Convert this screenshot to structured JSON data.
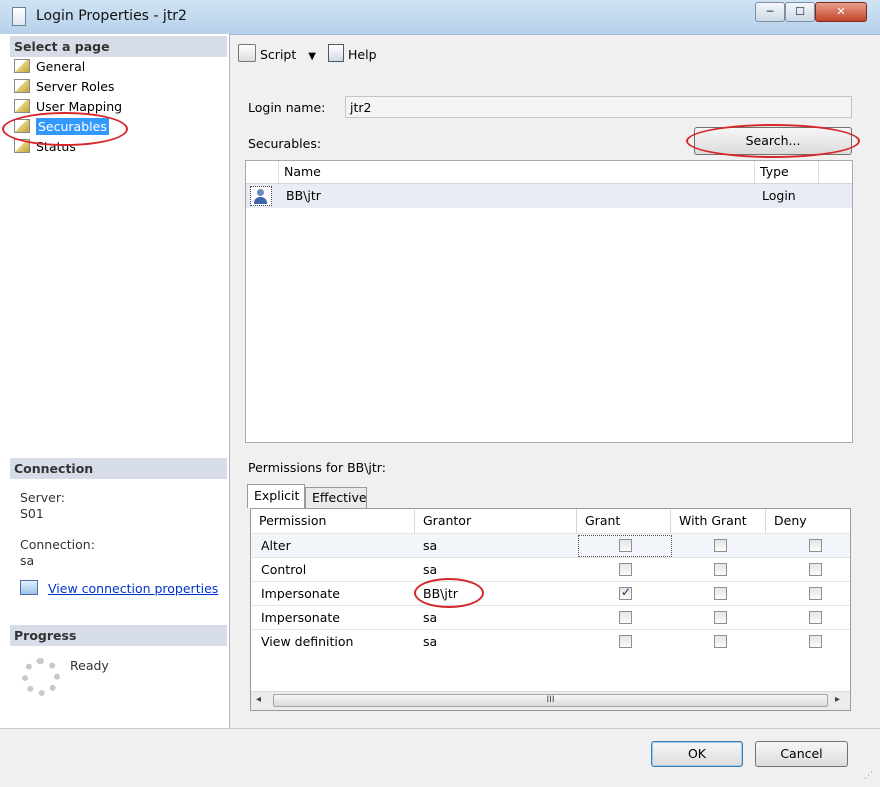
{
  "window": {
    "title": "Login Properties - jtr2",
    "minimize_glyph": "─",
    "maximize_glyph": "☐",
    "close_glyph": "✕"
  },
  "sidebar": {
    "select_page_header": "Select a page",
    "pages": [
      {
        "label": "General",
        "selected": false
      },
      {
        "label": "Server Roles",
        "selected": false
      },
      {
        "label": "User Mapping",
        "selected": false
      },
      {
        "label": "Securables",
        "selected": true
      },
      {
        "label": "Status",
        "selected": false
      }
    ],
    "connection_header": "Connection",
    "server_label": "Server:",
    "server_value": "S01",
    "connection_label": "Connection:",
    "connection_value": "sa",
    "view_connection_link": "View connection properties",
    "progress_header": "Progress",
    "progress_status": "Ready"
  },
  "toolbar": {
    "script_label": "Script",
    "help_label": "Help"
  },
  "main": {
    "login_name_label": "Login name:",
    "login_name_value": "jtr2",
    "securables_label": "Securables:",
    "search_button": "Search...",
    "securables_columns": [
      "Name",
      "Type"
    ],
    "securables_rows": [
      {
        "name": "BB\\jtr",
        "type": "Login"
      }
    ],
    "permissions_label": "Permissions for BB\\jtr:",
    "tabs": [
      "Explicit",
      "Effective"
    ],
    "permission_columns": [
      "Permission",
      "Grantor",
      "Grant",
      "With Grant",
      "Deny"
    ],
    "permission_rows": [
      {
        "permission": "Alter",
        "grantor": "sa",
        "grant": false,
        "with_grant": false,
        "deny": false
      },
      {
        "permission": "Control",
        "grantor": "sa",
        "grant": false,
        "with_grant": false,
        "deny": false
      },
      {
        "permission": "Impersonate",
        "grantor": "BB\\jtr",
        "grant": true,
        "with_grant": false,
        "deny": false
      },
      {
        "permission": "Impersonate",
        "grantor": "sa",
        "grant": false,
        "with_grant": false,
        "deny": false
      },
      {
        "permission": "View definition",
        "grantor": "sa",
        "grant": false,
        "with_grant": false,
        "deny": false
      }
    ],
    "scroll_left": "◂",
    "scroll_right": "▸",
    "scroll_grip": "III"
  },
  "footer": {
    "ok_button": "OK",
    "cancel_button": "Cancel"
  },
  "colors": {
    "selection": "#3399ff",
    "highlight_circle": "#d6262a",
    "link": "#0033cc"
  }
}
